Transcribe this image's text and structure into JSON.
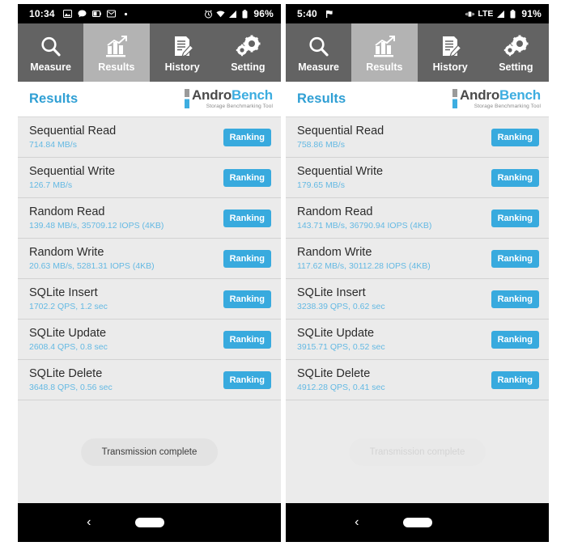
{
  "app": {
    "name": "AndroBench",
    "logo_andro": "Andro",
    "logo_bench": "Bench",
    "logo_subtitle": "Storage Benchmarking Tool",
    "accent_blue": "#38aade",
    "value_blue": "#64b9e3",
    "tab_bar_gray": "#636363",
    "tab_active_gray": "#b3b3b3",
    "row_gray": "#ebebeb"
  },
  "tabs": [
    {
      "label": "Measure",
      "icon": "magnifier-icon",
      "active": false
    },
    {
      "label": "Results",
      "icon": "bar-chart-icon",
      "active": true
    },
    {
      "label": "History",
      "icon": "document-pen-icon",
      "active": false
    },
    {
      "label": "Setting",
      "icon": "gears-icon",
      "active": false
    }
  ],
  "header": {
    "title": "Results"
  },
  "ranking_label": "Ranking",
  "toast": {
    "text": "Transmission complete"
  },
  "navbar": {
    "back": "back-chevron-icon",
    "home": "home-pill-icon"
  },
  "left_phone": {
    "statusbar": {
      "time": "10:34",
      "left_icons": [
        "image-icon",
        "chat-icon",
        "battery-saver-icon",
        "mail-icon",
        "dot-icon"
      ],
      "right_icons": [
        "alarm-icon",
        "wifi-icon",
        "signal-icon",
        "battery-icon"
      ],
      "battery": "96%"
    },
    "results": [
      {
        "title": "Sequential Read",
        "value": "714.84 MB/s"
      },
      {
        "title": "Sequential Write",
        "value": "126.7 MB/s"
      },
      {
        "title": "Random Read",
        "value": "139.48 MB/s, 35709.12 IOPS (4KB)"
      },
      {
        "title": "Random Write",
        "value": "20.63 MB/s, 5281.31 IOPS (4KB)"
      },
      {
        "title": "SQLite Insert",
        "value": "1702.2 QPS, 1.2 sec"
      },
      {
        "title": "SQLite Update",
        "value": "2608.4 QPS, 0.8 sec"
      },
      {
        "title": "SQLite Delete",
        "value": "3648.8 QPS, 0.56 sec"
      }
    ]
  },
  "right_phone": {
    "statusbar": {
      "time": "5:40",
      "left_icons": [
        "flag-icon"
      ],
      "right_icons": [
        "vibrate-icon",
        "lte-label",
        "signal-icon",
        "battery-icon"
      ],
      "network": "LTE",
      "battery": "91%"
    },
    "results": [
      {
        "title": "Sequential Read",
        "value": "758.86 MB/s"
      },
      {
        "title": "Sequential Write",
        "value": "179.65 MB/s"
      },
      {
        "title": "Random Read",
        "value": "143.71 MB/s, 36790.94 IOPS (4KB)"
      },
      {
        "title": "Random Write",
        "value": "117.62 MB/s, 30112.28 IOPS (4KB)"
      },
      {
        "title": "SQLite Insert",
        "value": "3238.39 QPS, 0.62 sec"
      },
      {
        "title": "SQLite Update",
        "value": "3915.71 QPS, 0.52 sec"
      },
      {
        "title": "SQLite Delete",
        "value": "4912.28 QPS, 0.41 sec"
      }
    ]
  }
}
